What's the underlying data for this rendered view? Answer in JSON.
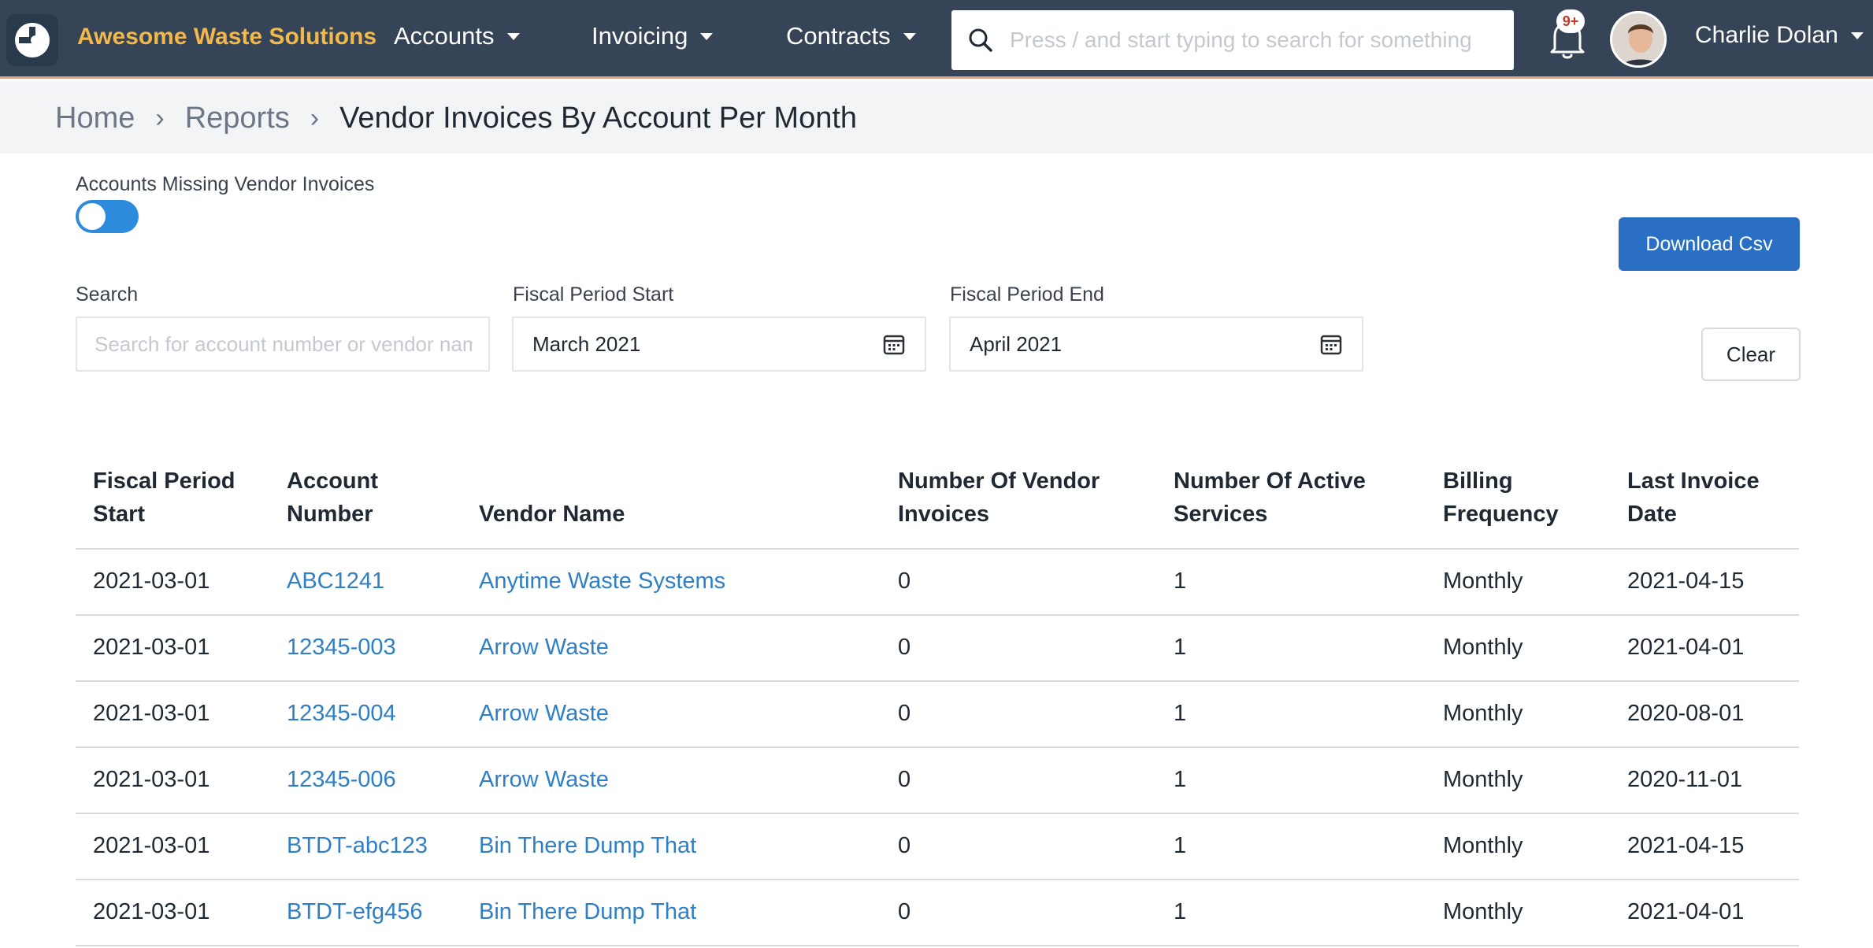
{
  "app": {
    "brand": "Awesome Waste Solutions",
    "nav": [
      {
        "label": "Accounts"
      },
      {
        "label": "Invoicing"
      },
      {
        "label": "Contracts"
      }
    ],
    "search_placeholder": "Press / and start typing to search for something",
    "notifications_badge": "9+",
    "user_name": "Charlie Dolan"
  },
  "breadcrumb": {
    "home": "Home",
    "reports": "Reports",
    "current": "Vendor Invoices By Account Per Month"
  },
  "filters": {
    "missing_label": "Accounts Missing Vendor Invoices",
    "missing_toggle_on": true,
    "download_label": "Download Csv",
    "search_label": "Search",
    "search_placeholder": "Search for account number or vendor name",
    "start_label": "Fiscal Period Start",
    "start_value": "March 2021",
    "end_label": "Fiscal Period End",
    "end_value": "April 2021",
    "clear_label": "Clear"
  },
  "table": {
    "headers": [
      [
        "Fiscal Period",
        "Start"
      ],
      [
        "Account",
        "Number"
      ],
      [
        "",
        "Vendor Name"
      ],
      [
        "Number Of Vendor",
        "Invoices"
      ],
      [
        "Number Of Active",
        "Services"
      ],
      [
        "Billing",
        "Frequency"
      ],
      [
        "Last Invoice",
        "Date"
      ]
    ],
    "rows": [
      {
        "period": "2021-03-01",
        "account": "ABC1241",
        "vendor": "Anytime Waste Systems",
        "invoices": "0",
        "services": "1",
        "frequency": "Monthly",
        "last_invoice": "2021-04-15"
      },
      {
        "period": "2021-03-01",
        "account": "12345-003",
        "vendor": "Arrow Waste",
        "invoices": "0",
        "services": "1",
        "frequency": "Monthly",
        "last_invoice": "2021-04-01"
      },
      {
        "period": "2021-03-01",
        "account": "12345-004",
        "vendor": "Arrow Waste",
        "invoices": "0",
        "services": "1",
        "frequency": "Monthly",
        "last_invoice": "2020-08-01"
      },
      {
        "period": "2021-03-01",
        "account": "12345-006",
        "vendor": "Arrow Waste",
        "invoices": "0",
        "services": "1",
        "frequency": "Monthly",
        "last_invoice": "2020-11-01"
      },
      {
        "period": "2021-03-01",
        "account": "BTDT-abc123",
        "vendor": "Bin There Dump That",
        "invoices": "0",
        "services": "1",
        "frequency": "Monthly",
        "last_invoice": "2021-04-15"
      },
      {
        "period": "2021-03-01",
        "account": "BTDT-efg456",
        "vendor": "Bin There Dump That",
        "invoices": "0",
        "services": "1",
        "frequency": "Monthly",
        "last_invoice": "2021-04-01"
      }
    ]
  },
  "colors": {
    "nav_bg": "#354457",
    "brand": "#f2b84b",
    "link": "#2e7fc6",
    "primary_button": "#2a6fc4",
    "toggle": "#2d8bdc"
  },
  "icons": [
    "logo-icon",
    "caret-down-icon",
    "search-icon",
    "bell-icon",
    "calendar-icon"
  ]
}
